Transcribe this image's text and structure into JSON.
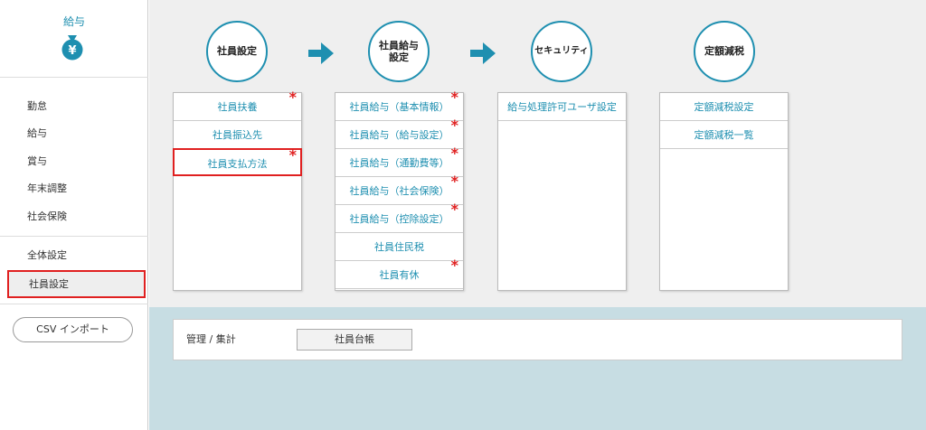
{
  "sidebar": {
    "title": "給与",
    "nav": {
      "items": [
        {
          "label": "勤怠"
        },
        {
          "label": "給与"
        },
        {
          "label": "賞与"
        },
        {
          "label": "年末調整"
        },
        {
          "label": "社会保険"
        },
        {
          "label": "全体設定"
        },
        {
          "label": "社員設定"
        }
      ]
    },
    "csv_button": "CSV インポート"
  },
  "steps": {
    "s1": "社員設定",
    "s2a": "社員給与",
    "s2b": "設定",
    "s3": "セキュリティ",
    "s4": "定額減税"
  },
  "columns": {
    "c1": [
      "社員扶養",
      "社員振込先",
      "社員支払方法"
    ],
    "c2": [
      "社員給与（基本情報）",
      "社員給与（給与設定）",
      "社員給与（通勤費等）",
      "社員給与（社会保険）",
      "社員給与（控除設定）",
      "社員住民税",
      "社員有休"
    ],
    "c3": [
      "給与処理許可ユーザ設定"
    ],
    "c4": [
      "定額減税設定",
      "定額減税一覧"
    ]
  },
  "required_mark": "*",
  "panel": {
    "label": "管理 / 集計",
    "button": "社員台帳"
  },
  "colors": {
    "accent": "#1e8fb0",
    "highlight": "#e02020",
    "main_bg": "#efefef",
    "lower_bg": "#c7dde3"
  }
}
